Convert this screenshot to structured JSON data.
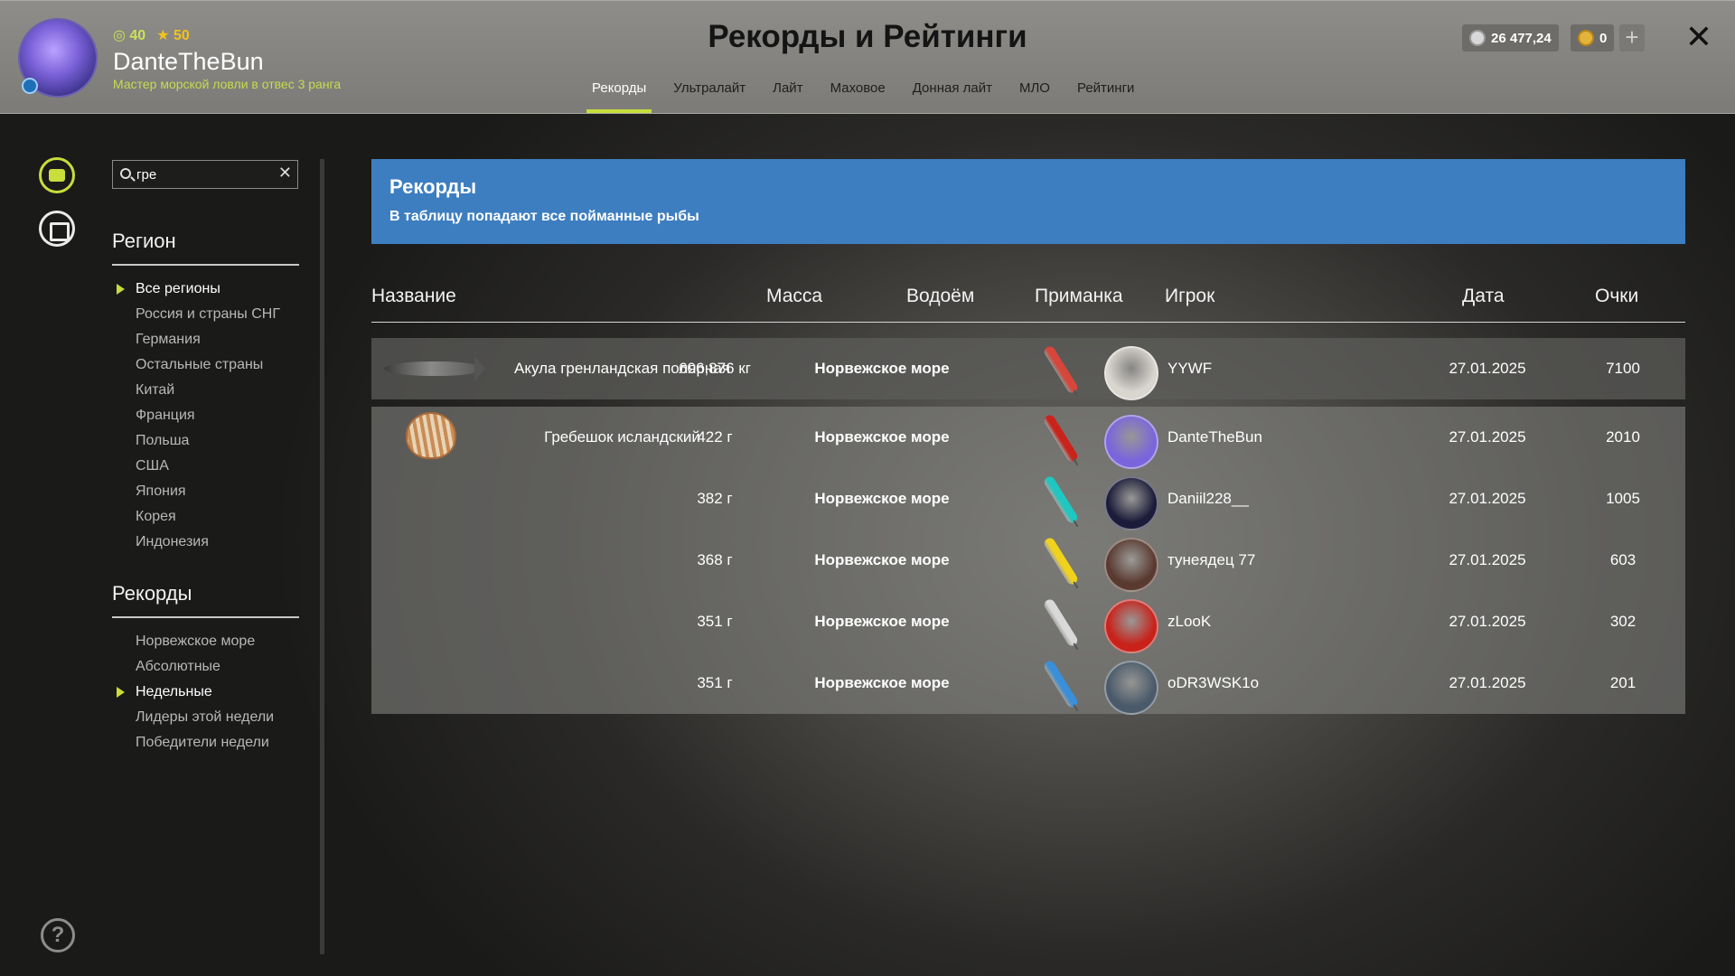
{
  "header": {
    "level": "40",
    "stars": "50",
    "player_name": "DanteTheBun",
    "player_title": "Мастер морской ловли в отвес 3 ранга",
    "title": "Рекорды и Рейтинги",
    "tabs": [
      {
        "label": "Рекорды",
        "active": true
      },
      {
        "label": "Ультралайт"
      },
      {
        "label": "Лайт"
      },
      {
        "label": "Маховое"
      },
      {
        "label": "Донная лайт"
      },
      {
        "label": "МЛО"
      },
      {
        "label": "Рейтинги"
      }
    ],
    "silver": "26 477,24",
    "gold": "0",
    "plus": "+",
    "close": "✕"
  },
  "filters": {
    "search_value": "гре",
    "clear": "✕",
    "region_title": "Регион",
    "regions": [
      {
        "label": "Все регионы",
        "active": true
      },
      {
        "label": "Россия и страны СНГ"
      },
      {
        "label": "Германия"
      },
      {
        "label": "Остальные страны"
      },
      {
        "label": "Китай"
      },
      {
        "label": "Франция"
      },
      {
        "label": "Польша"
      },
      {
        "label": "США"
      },
      {
        "label": "Япония"
      },
      {
        "label": "Корея"
      },
      {
        "label": "Индонезия"
      }
    ],
    "records_title": "Рекорды",
    "records": [
      {
        "label": "Норвежское море"
      },
      {
        "label": "Абсолютные"
      },
      {
        "label": "Недельные",
        "active": true
      },
      {
        "label": "Лидеры этой недели"
      },
      {
        "label": "Победители недели"
      }
    ]
  },
  "banner": {
    "title": "Рекорды",
    "subtitle": "В таблицу попадают все пойманные рыбы"
  },
  "table": {
    "columns": [
      "Название",
      "Масса",
      "Водоём",
      "Приманка",
      "Игрок",
      "Дата",
      "Очки"
    ],
    "groups": [
      {
        "fish": "Акула гренландская полярная",
        "rows": [
          {
            "mass": "606,876 кг",
            "water": "Норвежское море",
            "player": "YYWF",
            "date": "27.01.2025",
            "score": "7100",
            "lure_color": "#d7463a",
            "avatar_color": "#d9d5cf"
          }
        ]
      },
      {
        "fish": "Гребешок исландский",
        "rows": [
          {
            "mass": "422 г",
            "water": "Норвежское море",
            "player": "DanteTheBun",
            "date": "27.01.2025",
            "score": "2010",
            "lure_color": "#c8241c",
            "avatar_color": "#7b65dc"
          },
          {
            "mass": "382 г",
            "water": "Норвежское море",
            "player": "Daniil228__",
            "date": "27.01.2025",
            "score": "1005",
            "lure_color": "#1fc7c0",
            "avatar_color": "#1c1c3a"
          },
          {
            "mass": "368 г",
            "water": "Норвежское море",
            "player": "тунеядец 77",
            "date": "27.01.2025",
            "score": "603",
            "lure_color": "#f0d21c",
            "avatar_color": "#5a3a30"
          },
          {
            "mass": "351 г",
            "water": "Норвежское море",
            "player": "zLooK",
            "date": "27.01.2025",
            "score": "302",
            "lure_color": "#d9d9d9",
            "avatar_color": "#c8221a"
          },
          {
            "mass": "351 г",
            "water": "Норвежское море",
            "player": "oDR3WSK1o",
            "date": "27.01.2025",
            "score": "201",
            "lure_color": "#3a8fd8",
            "avatar_color": "#4a5a6a"
          }
        ]
      }
    ]
  },
  "help": "?"
}
